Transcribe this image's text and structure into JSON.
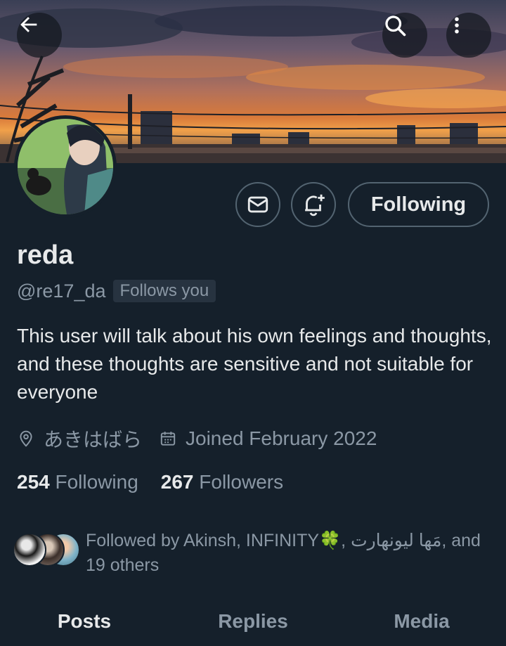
{
  "header": {
    "back_icon": "arrow-left-icon",
    "search_icon": "search-icon",
    "more_icon": "more-vertical-icon"
  },
  "profile": {
    "display_name": "reda",
    "handle": "@re17_da",
    "follows_you": "Follows you",
    "bio": "This user will talk about his own feelings and thoughts, and these thoughts are sensitive and not suitable for everyone",
    "location": "あきはばら",
    "joined": "Joined February 2022",
    "following_count": "254",
    "following_label": "Following",
    "followers_count": "267",
    "followers_label": "Followers",
    "followed_by_text": "Followed by Akinsh, INFINITY🍀, مَها ليونهارت, and 19 others"
  },
  "actions": {
    "message_icon": "mail-icon",
    "notify_icon": "bell-plus-icon",
    "following_button": "Following"
  },
  "tabs": [
    {
      "label": "Posts",
      "active": true
    },
    {
      "label": "Replies",
      "active": false
    },
    {
      "label": "Media",
      "active": false
    }
  ],
  "colors": {
    "background": "#15202b",
    "text_primary": "#e7e9ea",
    "text_secondary": "#8b98a5",
    "border": "#536471"
  }
}
